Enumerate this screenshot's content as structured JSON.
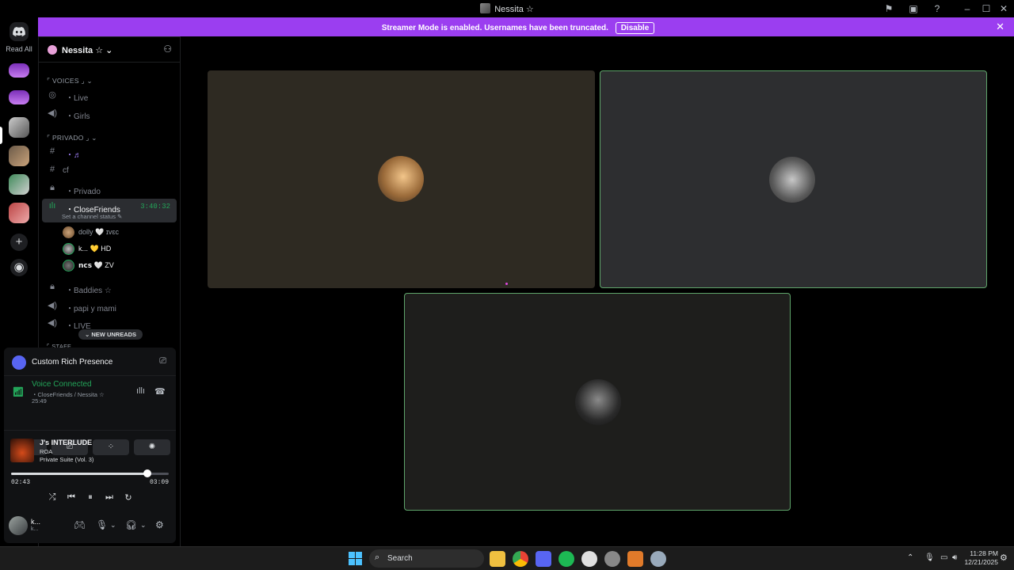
{
  "window": {
    "title": "Nessita ☆"
  },
  "banner": {
    "text": "Streamer Mode is enabled. Usernames have been truncated.",
    "button_label": "Disable"
  },
  "rail": {
    "read_all_label": "Read All"
  },
  "guild": {
    "name": "Nessita ☆ ⌄"
  },
  "categories": {
    "voices": "⌜ VOICES ⌟ ⌄",
    "privado": "⌜ PRIVADO ⌟ ⌄",
    "staff": "⌜ STAFF"
  },
  "channels": {
    "live": "・Live",
    "girls": "・Girls",
    "music": "・♬",
    "cf": "cf",
    "privado": "・Privado",
    "closefriends": "・CloseFriends",
    "closefriends_timer": "3:40:32",
    "closefriends_status": "Set a channel status ✎",
    "baddies": "・Baddies ☆",
    "papi": "・papi y mami",
    "live2": "・LIVE"
  },
  "voice_users": [
    {
      "name": "dolly  🤍 ɪᴠɛᴄ"
    },
    {
      "name": "k...  💛 HD"
    },
    {
      "name": "𝗻𝗰𝘀  🤍 ZV"
    }
  ],
  "new_unreads": "⌄ NEW UNREADS",
  "rich_presence": {
    "title": "Custom Rich Presence"
  },
  "voice_connected": {
    "title": "Voice Connected",
    "subtitle": "・CloseFriends / Nessita ☆",
    "timer": "25:49"
  },
  "music": {
    "title": "J's INTERLUDE",
    "artist": "ROA",
    "album": "Private Suite (Vol. 3)",
    "current_time": "02:43",
    "total_time": "03:09",
    "progress": 0.862
  },
  "user": {
    "name": "k...",
    "sub": "k..."
  },
  "taskbar": {
    "search_label": "Search",
    "time": "11:28 PM",
    "date": "12/21/2025"
  },
  "icons": {
    "discord": "discord-icon",
    "inbox": "inbox-icon",
    "help": "help-icon",
    "minimize": "minimize-icon",
    "maximize": "maximize-icon",
    "close": "close-icon"
  },
  "colors": {
    "banner": "#9b3ef0",
    "voice_green": "#23a559",
    "tile_border": "#5ea46a"
  }
}
